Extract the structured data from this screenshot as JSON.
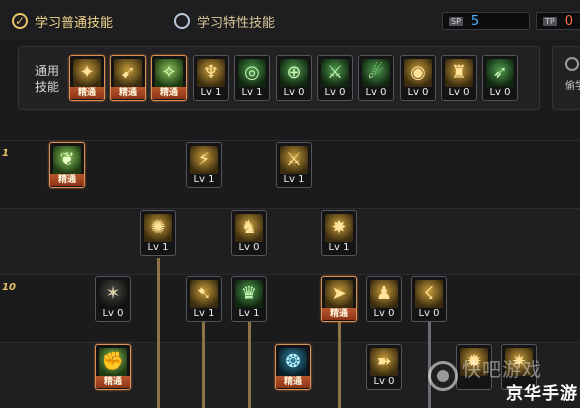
{
  "tabs": [
    {
      "label": "学习普通技能",
      "selected": true
    },
    {
      "label": "学习特性技能",
      "selected": false
    }
  ],
  "sp": {
    "icon_text": "SP",
    "value": "5"
  },
  "tp": {
    "icon_text": "TP",
    "value": "0"
  },
  "colors": {
    "accent": "#e9c56a",
    "sp_value": "#4fb3ff",
    "tp_value": "#ff6a3a",
    "mastered_border": "#d89458",
    "connector": "#8c7448"
  },
  "common": {
    "label": "通用技能",
    "skills": [
      {
        "icon": "kick-icon",
        "glyph": "✦",
        "style": "gold",
        "level": "精通",
        "mastered": true
      },
      {
        "icon": "backstep-icon",
        "glyph": "➹",
        "style": "gold",
        "level": "精通",
        "mastered": true
      },
      {
        "icon": "leap-icon",
        "glyph": "✧",
        "style": "lime",
        "level": "精通",
        "mastered": true
      },
      {
        "icon": "wing-icon",
        "glyph": "♆",
        "style": "gold",
        "level": "Lv 1",
        "mastered": false
      },
      {
        "icon": "target-icon",
        "glyph": "◎",
        "style": "green",
        "level": "Lv 1",
        "mastered": false
      },
      {
        "icon": "crosshair-icon",
        "glyph": "⊕",
        "style": "green",
        "level": "Lv 0",
        "mastered": false
      },
      {
        "icon": "slash-icon",
        "glyph": "⚔",
        "style": "green",
        "level": "Lv 0",
        "mastered": false
      },
      {
        "icon": "dash-icon",
        "glyph": "☄",
        "style": "green",
        "level": "Lv 0",
        "mastered": false
      },
      {
        "icon": "eye-icon",
        "glyph": "◉",
        "style": "gold",
        "level": "Lv 0",
        "mastered": false
      },
      {
        "icon": "strength-icon",
        "glyph": "♜",
        "style": "gold",
        "level": "Lv 0",
        "mastered": false
      },
      {
        "icon": "sprint-icon",
        "glyph": "➶",
        "style": "green",
        "level": "Lv 0",
        "mastered": false
      }
    ]
  },
  "side_panel": {
    "label": "偷学"
  },
  "tree": {
    "levels": [
      "1",
      "10"
    ],
    "skills": [
      {
        "icon": "leaf-kick-icon",
        "glyph": "❦",
        "style": "lime",
        "level": "精通",
        "mastered": true
      },
      {
        "icon": "slash-up-icon",
        "glyph": "⚡",
        "style": "gold",
        "level": "Lv 1",
        "mastered": false
      },
      {
        "icon": "blade-icon",
        "glyph": "⚔",
        "style": "gold",
        "level": "Lv 1",
        "mastered": false
      },
      {
        "icon": "spin-icon",
        "glyph": "✺",
        "style": "gold",
        "level": "Lv 1",
        "mastered": false
      },
      {
        "icon": "fighter-icon",
        "glyph": "♞",
        "style": "gold",
        "level": "Lv 0",
        "mastered": false
      },
      {
        "icon": "burst-icon",
        "glyph": "✸",
        "style": "gold",
        "level": "Lv 1",
        "mastered": false
      },
      {
        "icon": "shatter-icon",
        "glyph": "✶",
        "style": "dark",
        "level": "Lv 0",
        "mastered": false
      },
      {
        "icon": "uppercut-icon",
        "glyph": "➷",
        "style": "gold",
        "level": "Lv 1",
        "mastered": false
      },
      {
        "icon": "armor-icon",
        "glyph": "♛",
        "style": "green",
        "level": "Lv 1",
        "mastered": false
      },
      {
        "icon": "runner-icon",
        "glyph": "➤",
        "style": "gold",
        "level": "精通",
        "mastered": true
      },
      {
        "icon": "crouch-icon",
        "glyph": "♟",
        "style": "gold",
        "level": "Lv 0",
        "mastered": false
      },
      {
        "icon": "swing-icon",
        "glyph": "☇",
        "style": "gold",
        "level": "Lv 0",
        "mastered": false
      },
      {
        "icon": "fist-icon",
        "glyph": "✊",
        "style": "lime",
        "level": "精通",
        "mastered": true
      },
      {
        "icon": "aura-icon",
        "glyph": "❂",
        "style": "blue",
        "level": "精通",
        "mastered": true
      },
      {
        "icon": "rush-icon",
        "glyph": "➽",
        "style": "gold",
        "level": "Lv 0",
        "mastered": false
      },
      {
        "icon": "flame-icon",
        "glyph": "✹",
        "style": "gold",
        "level": "",
        "mastered": false
      },
      {
        "icon": "claw-icon",
        "glyph": "✷",
        "style": "gold",
        "level": "",
        "mastered": false
      }
    ]
  },
  "watermark": {
    "line1": "快吧游戏",
    "line2": "京华手游"
  }
}
